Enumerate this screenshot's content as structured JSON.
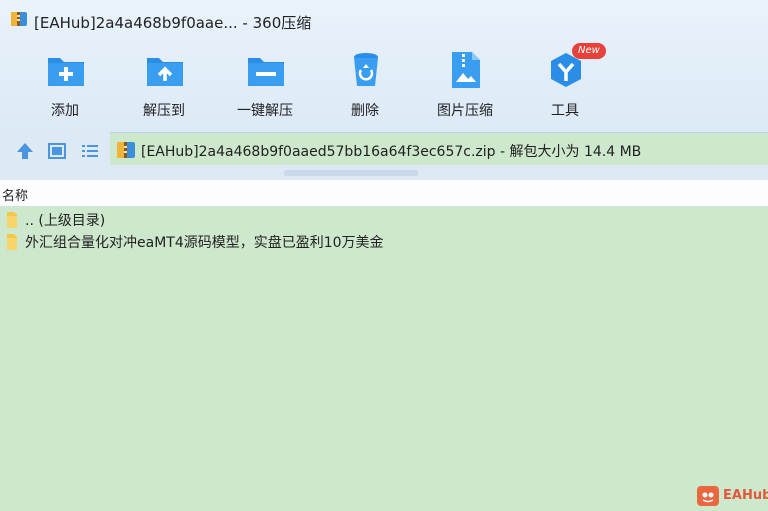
{
  "window": {
    "title": "[EAHub]2a4a468b9f0aae... - 360压缩"
  },
  "toolbar": {
    "items": [
      {
        "label": "添加",
        "icon": "add-icon"
      },
      {
        "label": "解压到",
        "icon": "extract-to-icon"
      },
      {
        "label": "一键解压",
        "icon": "one-click-extract-icon"
      },
      {
        "label": "删除",
        "icon": "delete-icon"
      },
      {
        "label": "图片压缩",
        "icon": "image-compress-icon"
      },
      {
        "label": "工具",
        "icon": "tools-icon",
        "badge": "New"
      }
    ]
  },
  "addressbar": {
    "path_text": "[EAHub]2a4a468b9f0aaed57bb16a64f3ec657c.zip - 解包大小为 14.4 MB",
    "buttons": [
      "up-arrow-icon",
      "thumbnail-view-icon",
      "list-view-icon"
    ]
  },
  "filelist": {
    "column_header": "名称",
    "rows": [
      {
        "name": ".. (上级目录)",
        "icon": "folder-icon"
      },
      {
        "name": "外汇组合量化对冲eaMT4源码模型，实盘已盈利10万美金",
        "icon": "folder-icon"
      }
    ]
  },
  "watermark": {
    "text": "EAHub"
  },
  "colors": {
    "background": "#cde8cc",
    "toolbar": "#e4eff9",
    "accent_blue": "#2a8ee6",
    "badge_red": "#e8413c"
  }
}
